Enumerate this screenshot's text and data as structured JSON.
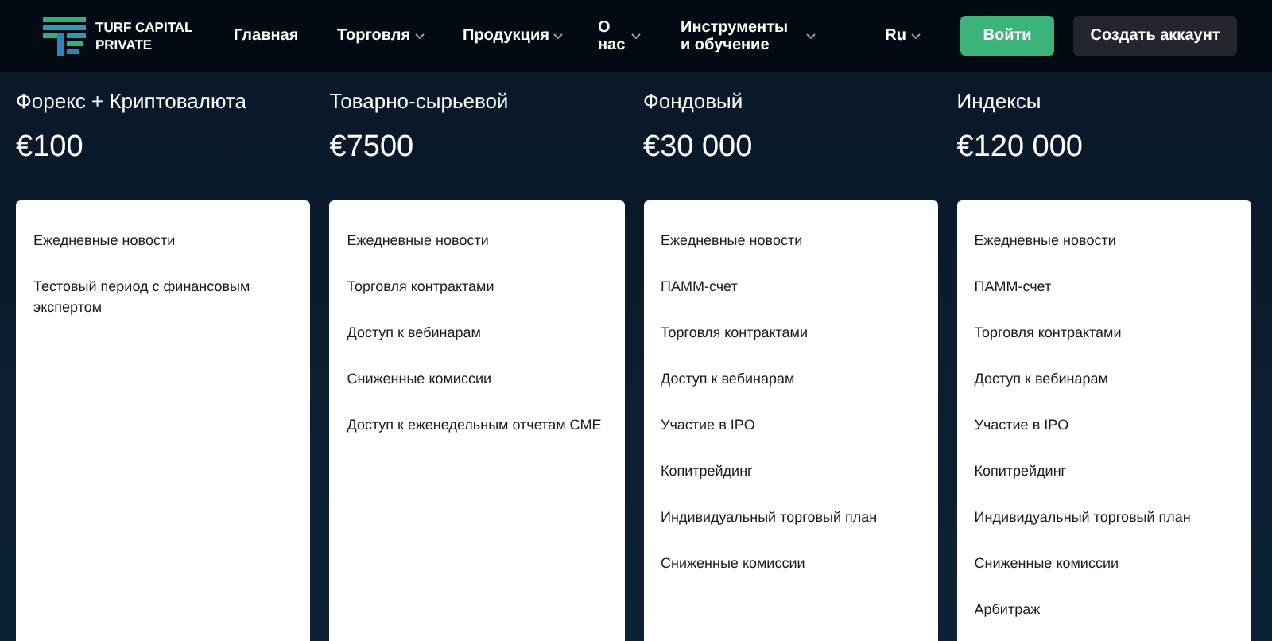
{
  "header": {
    "logo": {
      "line1": "TURF CAPITAL",
      "line2": "PRIVATE"
    },
    "nav": [
      {
        "label": "Главная",
        "dropdown": false
      },
      {
        "label": "Торговля",
        "dropdown": true
      },
      {
        "label": "Продукция",
        "dropdown": true
      },
      {
        "label": "О нас",
        "dropdown": true
      },
      {
        "label": "Инструменты и обучение",
        "dropdown": true
      }
    ],
    "language": "Ru",
    "login": "Войти",
    "signup": "Создать аккаунт"
  },
  "plans": [
    {
      "title": "Форекс + Криптовалюта",
      "price": "€100",
      "features": [
        "Ежедневные новости",
        "Тестовый период с финансовым экспертом"
      ]
    },
    {
      "title": "Товарно-сырьевой",
      "price": "€7500",
      "features": [
        "Ежедневные новости",
        "Торговля контрактами",
        "Доступ к вебинарам",
        "Сниженные комиссии",
        "Доступ к еженедельным отчетам CME"
      ]
    },
    {
      "title": "Фондовый",
      "price": "€30 000",
      "features": [
        "Ежедневные новости",
        "ПАММ-счет",
        "Торговля контрактами",
        "Доступ к вебинарам",
        "Участие в IPO",
        "Копитрейдинг",
        "Индивидуальный торговый план",
        "Сниженные комиссии"
      ]
    },
    {
      "title": "Индексы",
      "price": "€120 000",
      "features": [
        "Ежедневные новости",
        "ПАММ-счет",
        "Торговля контрактами",
        "Доступ к вебинарам",
        "Участие в IPO",
        "Копитрейдинг",
        "Индивидуальный торговый план",
        "Сниженные комиссии",
        "Арбитраж"
      ]
    }
  ]
}
